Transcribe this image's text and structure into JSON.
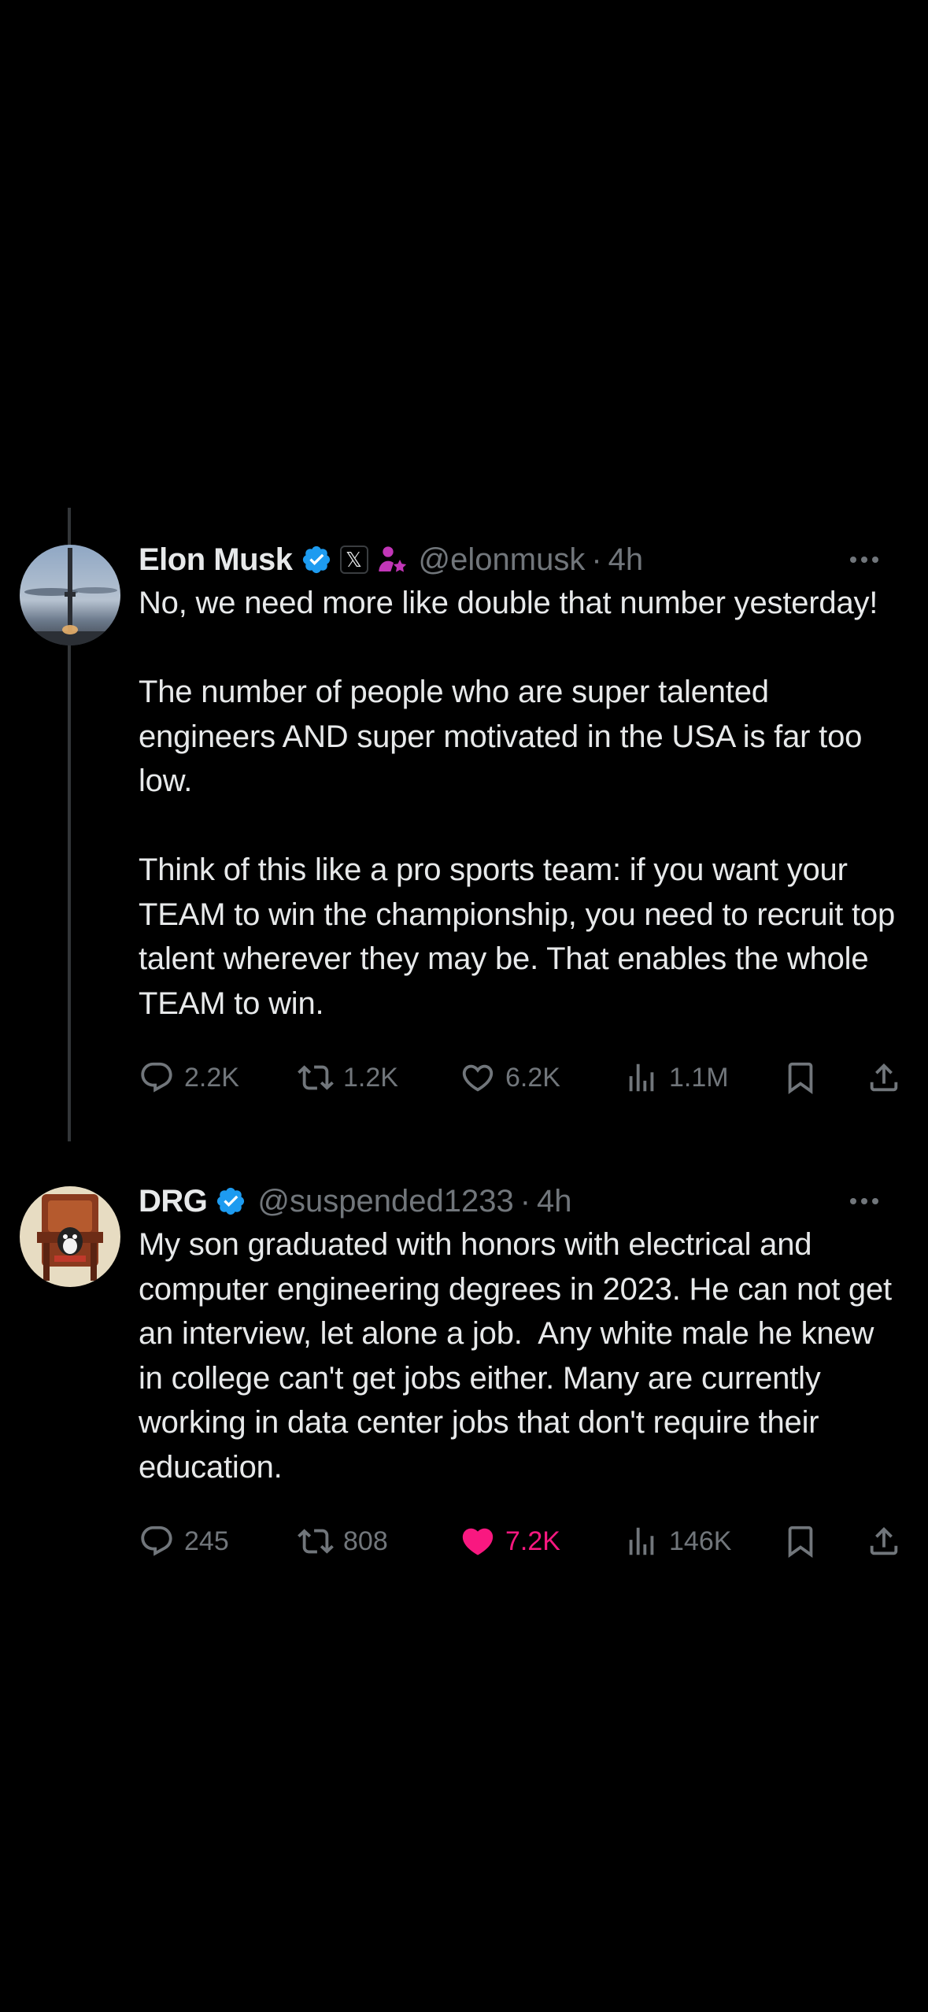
{
  "colors": {
    "background": "#000000",
    "text": "#e7e9ea",
    "muted": "#71767b",
    "verified": "#1d9bf0",
    "like_active": "#f91880",
    "affiliate": "#c236b8"
  },
  "tweets": [
    {
      "author": {
        "name": "Elon Musk",
        "handle": "@elonmusk",
        "verified_icon": "verified-badge-icon",
        "org_badge": "𝕏",
        "extra_icon": "affiliate-person-icon"
      },
      "separator": "·",
      "time": "4h",
      "text": "No, we need more like double that number yesterday!\n\nThe number of people who are super talented engineers AND super motivated in the USA is far too low.\n\nThink of this like a pro sports team: if you want your TEAM to win the championship, you need to recruit top talent wherever they may be. That enables the whole TEAM to win.",
      "stats": {
        "replies": "2.2K",
        "retweets": "1.2K",
        "likes": "6.2K",
        "views": "1.1M"
      },
      "liked": false
    },
    {
      "author": {
        "name": "DRG",
        "handle": "@suspended1233",
        "verified_icon": "verified-badge-icon"
      },
      "separator": "·",
      "time": "4h",
      "text": "My son graduated with honors with electrical and computer engineering degrees in 2023. He can not get an interview, let alone a job.  Any white male he knew in college can't get jobs either. Many are currently working in data center jobs that don't require their education.",
      "stats": {
        "replies": "245",
        "retweets": "808",
        "likes": "7.2K",
        "views": "146K"
      },
      "liked": true
    }
  ]
}
